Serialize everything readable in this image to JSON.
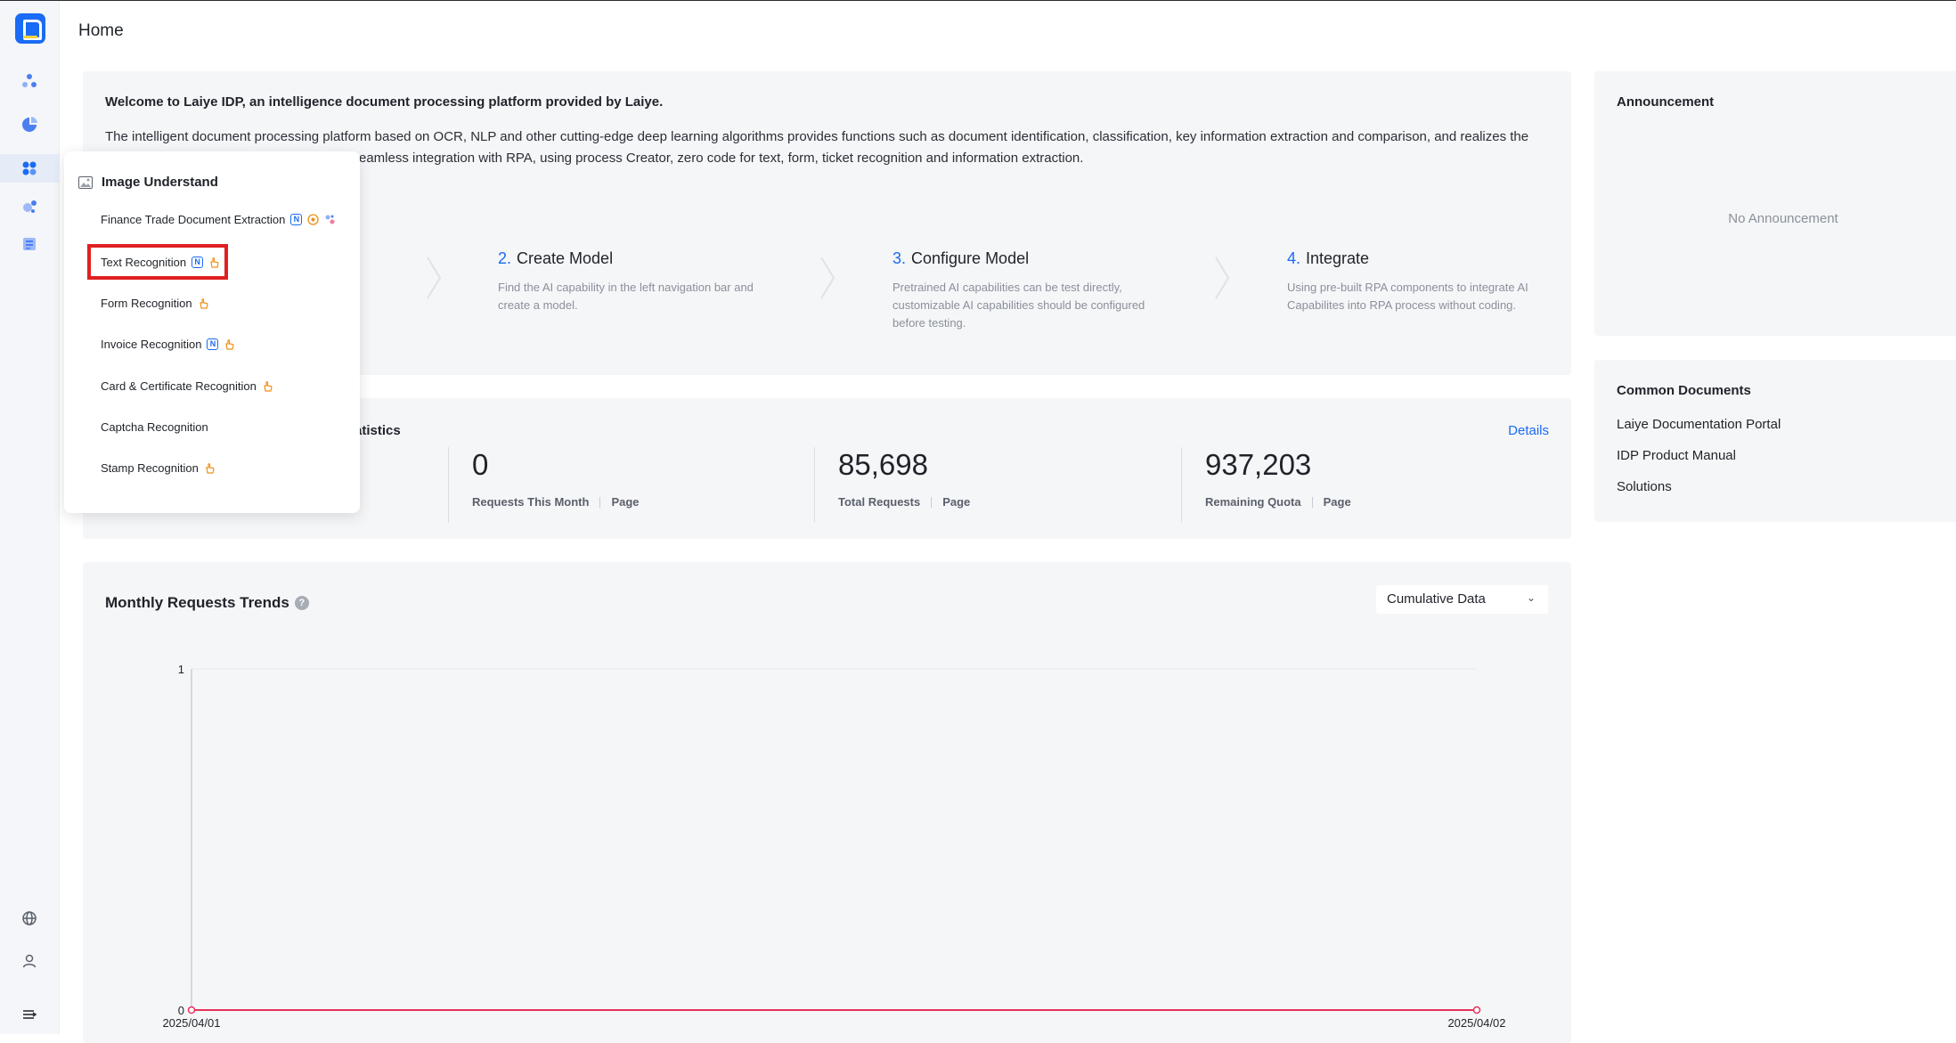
{
  "page": {
    "title": "Home"
  },
  "sidebar": {
    "icons": [
      "app-logo",
      "flow-icon",
      "chart-icon",
      "apps-icon",
      "model-icon",
      "document-icon",
      "globe-icon",
      "user-icon",
      "menu-toggle-icon"
    ]
  },
  "welcome": {
    "title": "Welcome to Laiye IDP, an intelligence document processing platform provided by Laiye.",
    "desc_line1": "The intelligent document processing platform based on OCR, NLP and other cutting-edge deep learning algorithms provides functions such as document identification, classification, key information extraction and comparison, and realizes the",
    "desc_line2": "eamless integration with RPA, using process Creator, zero code for text, form, ticket recognition and information extraction.",
    "steps": [
      {
        "num": "2.",
        "title": "Create Model",
        "desc": "Find the AI capability in the left navigation bar and create a model."
      },
      {
        "num": "3.",
        "title": "Configure Model",
        "desc": "Pretrained AI capabilities can be test directly, customizable AI capabilities should be configured before testing."
      },
      {
        "num": "4.",
        "title": "Integrate",
        "desc": "Using pre-built RPA components to integrate AI Capabilites into RPA process without coding."
      }
    ]
  },
  "stats": {
    "title": "tatistics",
    "details_label": "Details",
    "items": [
      {
        "value": "0",
        "label": "Requests This Month",
        "unit": "Page"
      },
      {
        "value": "85,698",
        "label": "Total Requests",
        "unit": "Page"
      },
      {
        "value": "937,203",
        "label": "Remaining Quota",
        "unit": "Page"
      }
    ]
  },
  "trends": {
    "title": "Monthly Requests Trends",
    "help": "?",
    "select_value": "Cumulative Data"
  },
  "chart_data": {
    "type": "line",
    "x": [
      "2025/04/01",
      "2025/04/02"
    ],
    "series": [
      {
        "values": [
          0,
          0
        ]
      }
    ],
    "ylim": [
      0,
      1
    ],
    "yticks": [
      "1",
      "0"
    ],
    "color": "#e8305a"
  },
  "announcement": {
    "title": "Announcement",
    "empty_text": "No Announcement"
  },
  "common_docs": {
    "title": "Common Documents",
    "links": [
      "Laiye Documentation Portal",
      "IDP Product Manual",
      "Solutions"
    ]
  },
  "popup": {
    "header": "Image Understand",
    "items": [
      {
        "label": "Finance Trade Document Extraction",
        "badges": [
          "n-badge",
          "star-badge",
          "ai-badge"
        ]
      },
      {
        "label": "Text Recognition",
        "badges": [
          "n-badge",
          "hand-badge"
        ]
      },
      {
        "label": "Form Recognition",
        "badges": [
          "hand-badge"
        ]
      },
      {
        "label": "Invoice Recognition",
        "badges": [
          "n-badge",
          "hand-badge"
        ]
      },
      {
        "label": "Card & Certificate Recognition",
        "badges": [
          "hand-badge"
        ]
      },
      {
        "label": "Captcha Recognition",
        "badges": []
      },
      {
        "label": "Stamp Recognition",
        "badges": [
          "hand-badge"
        ]
      }
    ],
    "badge_n_text": "N"
  },
  "colors": {
    "accent": "#1a6bf5",
    "highlight": "#e02020",
    "badge_orange": "#f0901a"
  }
}
